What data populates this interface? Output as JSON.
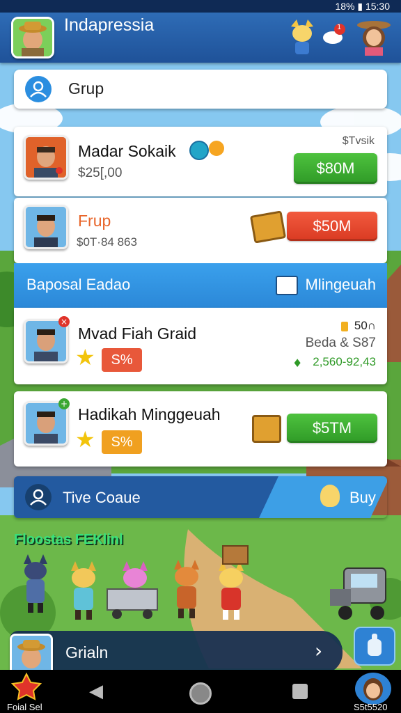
{
  "status_bar": {
    "battery_time": "18% ▮ 15:30"
  },
  "header": {
    "title": "Indapressia",
    "notification_count": "1"
  },
  "search": {
    "label": "Grup"
  },
  "cards": [
    {
      "name": "Madar Sokaik",
      "sub": "$25[,00",
      "corner": "$Tvsik",
      "button": "$80M",
      "button_color": "#3aa732"
    },
    {
      "name": "Frup",
      "sub": "$0T·84 863",
      "button": "$50M",
      "button_color": "#e44a2e"
    }
  ],
  "section": {
    "title": "Baposal Eadao",
    "right_label": "Mlingeuah"
  },
  "rows": [
    {
      "name": "Mvad Fiah Graid",
      "percent": "S%",
      "stat1": "50∩",
      "stat2": "Beda & S87",
      "stat3": "2,560-92,43"
    },
    {
      "name": "Hadikah Minggeuah",
      "percent": "S%",
      "button": "$5TM"
    }
  ],
  "tive": {
    "label": "Tive Coaue",
    "buy": "Buy"
  },
  "banner": {
    "text": "Floostas FEKlinl"
  },
  "bottom": {
    "label": "Grialn"
  },
  "nav": {
    "left_label": "Foial Sel",
    "right_label": "S5t5520"
  },
  "colors": {
    "header": "#2663ad",
    "accent_blue": "#2f8fe0",
    "green": "#3aa732",
    "red": "#e44a2e",
    "orange": "#f0a020"
  }
}
